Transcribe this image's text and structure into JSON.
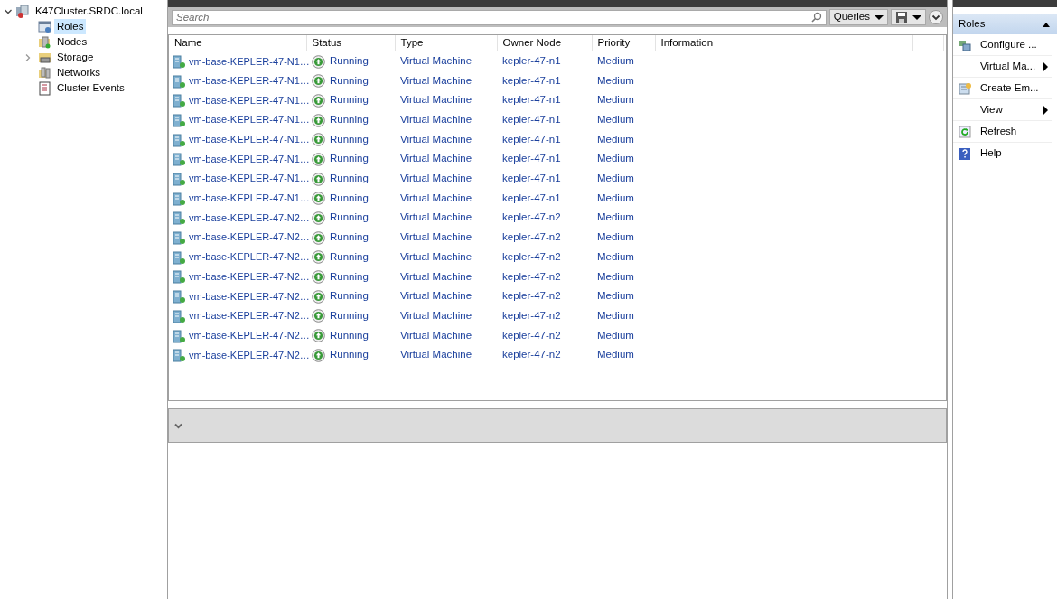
{
  "tree": {
    "label": "K47Cluster.SRDC.local",
    "expanded": true,
    "children": [
      {
        "label": "Roles",
        "kind": "roles",
        "expandable": false,
        "selected": true
      },
      {
        "label": "Nodes",
        "kind": "nodes",
        "expandable": false,
        "selected": false
      },
      {
        "label": "Storage",
        "kind": "storage",
        "expandable": true,
        "selected": false
      },
      {
        "label": "Networks",
        "kind": "networks",
        "expandable": false,
        "selected": false
      },
      {
        "label": "Cluster Events",
        "kind": "events",
        "expandable": false,
        "selected": false
      }
    ]
  },
  "search": {
    "placeholder": "Search"
  },
  "toolbar": {
    "queries": "Queries"
  },
  "table": {
    "columns": [
      "Name",
      "Status",
      "Type",
      "Owner Node",
      "Priority",
      "Information"
    ],
    "rows": [
      {
        "name": "vm-base-KEPLER-47-N1…",
        "status": "Running",
        "type": "Virtual Machine",
        "owner": "kepler-47-n1",
        "priority": "Medium"
      },
      {
        "name": "vm-base-KEPLER-47-N1…",
        "status": "Running",
        "type": "Virtual Machine",
        "owner": "kepler-47-n1",
        "priority": "Medium"
      },
      {
        "name": "vm-base-KEPLER-47-N1…",
        "status": "Running",
        "type": "Virtual Machine",
        "owner": "kepler-47-n1",
        "priority": "Medium"
      },
      {
        "name": "vm-base-KEPLER-47-N1…",
        "status": "Running",
        "type": "Virtual Machine",
        "owner": "kepler-47-n1",
        "priority": "Medium"
      },
      {
        "name": "vm-base-KEPLER-47-N1…",
        "status": "Running",
        "type": "Virtual Machine",
        "owner": "kepler-47-n1",
        "priority": "Medium"
      },
      {
        "name": "vm-base-KEPLER-47-N1…",
        "status": "Running",
        "type": "Virtual Machine",
        "owner": "kepler-47-n1",
        "priority": "Medium"
      },
      {
        "name": "vm-base-KEPLER-47-N1…",
        "status": "Running",
        "type": "Virtual Machine",
        "owner": "kepler-47-n1",
        "priority": "Medium"
      },
      {
        "name": "vm-base-KEPLER-47-N1…",
        "status": "Running",
        "type": "Virtual Machine",
        "owner": "kepler-47-n1",
        "priority": "Medium"
      },
      {
        "name": "vm-base-KEPLER-47-N2…",
        "status": "Running",
        "type": "Virtual Machine",
        "owner": "kepler-47-n2",
        "priority": "Medium"
      },
      {
        "name": "vm-base-KEPLER-47-N2…",
        "status": "Running",
        "type": "Virtual Machine",
        "owner": "kepler-47-n2",
        "priority": "Medium"
      },
      {
        "name": "vm-base-KEPLER-47-N2…",
        "status": "Running",
        "type": "Virtual Machine",
        "owner": "kepler-47-n2",
        "priority": "Medium"
      },
      {
        "name": "vm-base-KEPLER-47-N2…",
        "status": "Running",
        "type": "Virtual Machine",
        "owner": "kepler-47-n2",
        "priority": "Medium"
      },
      {
        "name": "vm-base-KEPLER-47-N2…",
        "status": "Running",
        "type": "Virtual Machine",
        "owner": "kepler-47-n2",
        "priority": "Medium"
      },
      {
        "name": "vm-base-KEPLER-47-N2…",
        "status": "Running",
        "type": "Virtual Machine",
        "owner": "kepler-47-n2",
        "priority": "Medium"
      },
      {
        "name": "vm-base-KEPLER-47-N2…",
        "status": "Running",
        "type": "Virtual Machine",
        "owner": "kepler-47-n2",
        "priority": "Medium"
      },
      {
        "name": "vm-base-KEPLER-47-N2…",
        "status": "Running",
        "type": "Virtual Machine",
        "owner": "kepler-47-n2",
        "priority": "Medium"
      }
    ]
  },
  "detail": {
    "expanded": false
  },
  "actions": {
    "section": "Roles",
    "expanded": true,
    "items": [
      {
        "label": "Configure ...",
        "kind": "configure"
      },
      {
        "label": "Virtual Ma...",
        "kind": "submenu"
      },
      {
        "label": "Create Em...",
        "kind": "create"
      },
      {
        "label": "View",
        "kind": "submenu"
      },
      {
        "label": "Refresh",
        "kind": "refresh"
      },
      {
        "label": "Help",
        "kind": "help"
      }
    ]
  }
}
